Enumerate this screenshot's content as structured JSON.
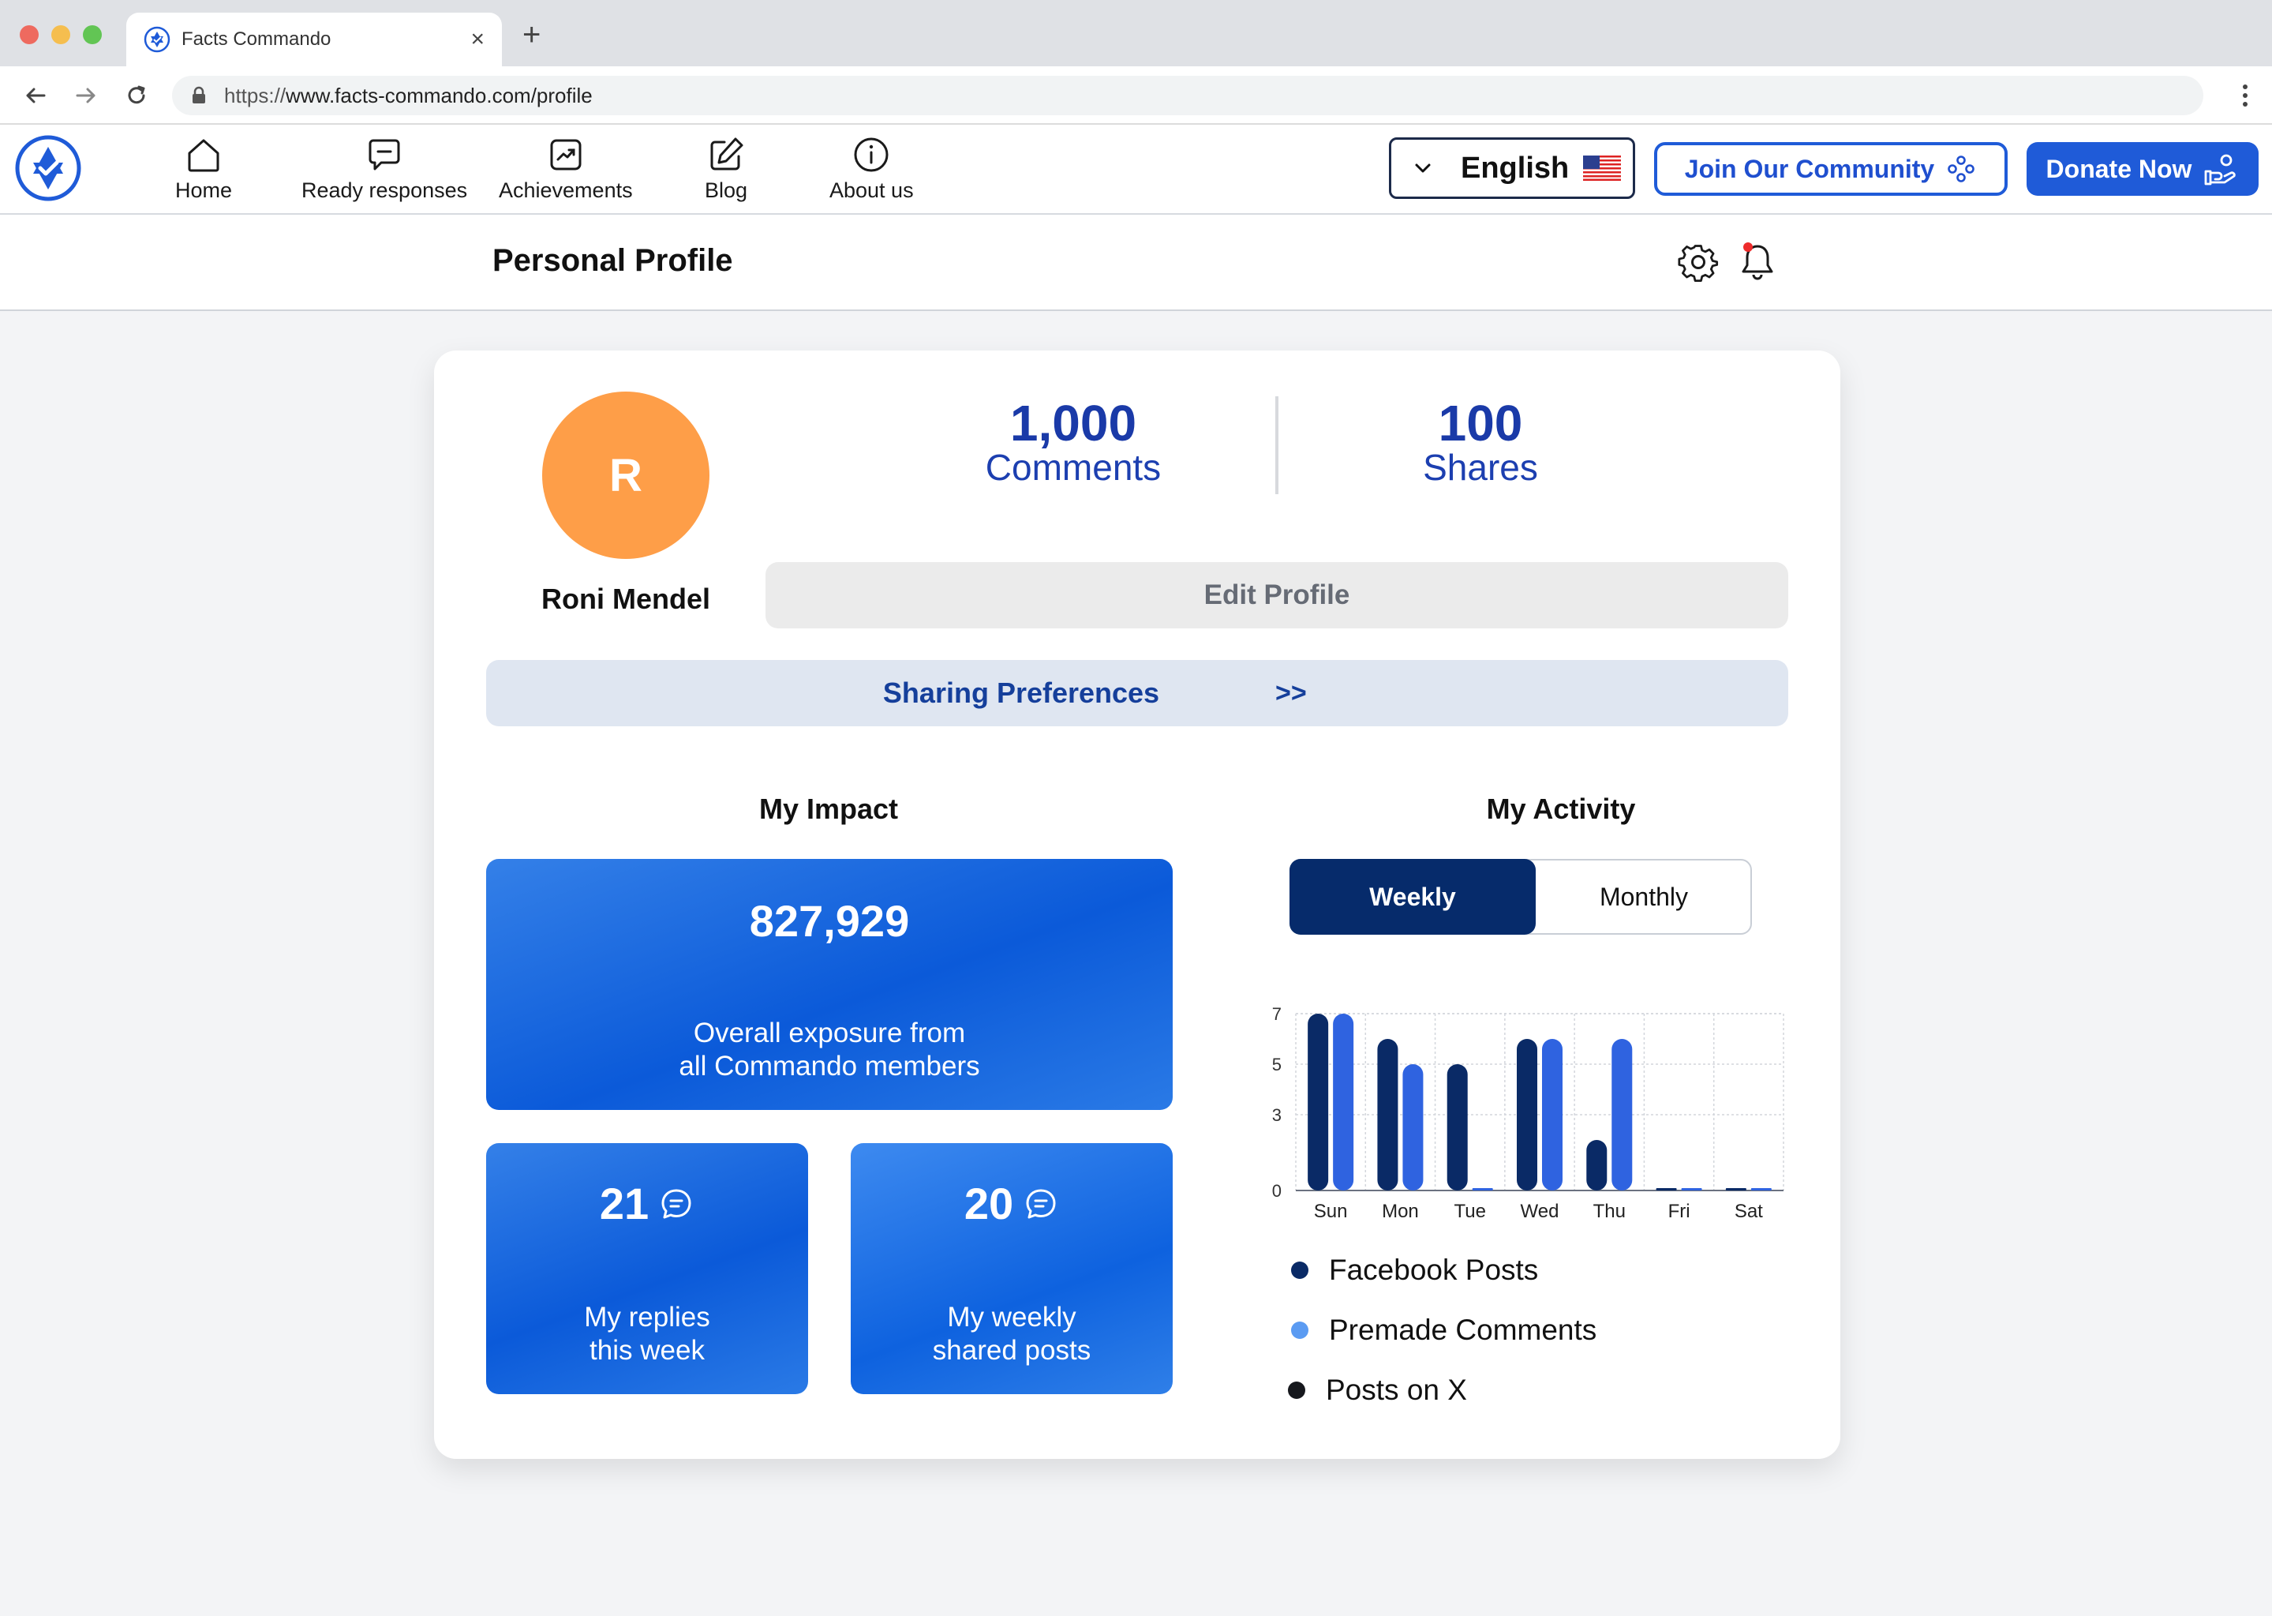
{
  "browser": {
    "tab_title": "Facts Commando",
    "url_scheme": "https://",
    "url_host": "www.facts-commando.com/profile"
  },
  "nav": {
    "items": [
      {
        "label": "Home",
        "icon": "home-icon"
      },
      {
        "label": "Ready responses",
        "icon": "chat-icon"
      },
      {
        "label": "Achievements",
        "icon": "chart-icon"
      },
      {
        "label": "Blog",
        "icon": "edit-icon"
      },
      {
        "label": "About us",
        "icon": "info-icon"
      }
    ],
    "language": "English",
    "join_label": "Join Our Community",
    "donate_label": "Donate Now"
  },
  "subheader": {
    "title": "Personal Profile"
  },
  "profile": {
    "initial": "R",
    "name": "Roni Mendel",
    "avatar_color": "#fe9e48",
    "stats": {
      "comments_value": "1,000",
      "comments_label": "Comments",
      "shares_value": "100",
      "shares_label": "Shares"
    },
    "edit_label": "Edit Profile",
    "sharing_label": "Sharing Preferences",
    "sharing_arrow": ">>"
  },
  "impact": {
    "title": "My Impact",
    "exposure_value": "827,929",
    "exposure_desc_line1": "Overall exposure from",
    "exposure_desc_line2": "all Commando members",
    "replies_value": "21",
    "replies_desc_line1": "My replies",
    "replies_desc_line2": "this week",
    "shared_value": "20",
    "shared_desc_line1": "My weekly",
    "shared_desc_line2": "shared posts"
  },
  "activity": {
    "title": "My Activity",
    "toggle_weekly": "Weekly",
    "toggle_monthly": "Monthly",
    "legend": [
      {
        "label": "Facebook Posts",
        "color": "#0a2a66"
      },
      {
        "label": "Premade Comments",
        "color": "#5b9bf2"
      },
      {
        "label": "Posts on X",
        "color": "#16181d"
      }
    ]
  },
  "chart_data": {
    "type": "bar",
    "categories": [
      "Sun",
      "Mon",
      "Tue",
      "Wed",
      "Thu",
      "Fri",
      "Sat"
    ],
    "series": [
      {
        "name": "Facebook Posts",
        "color": "#0a2a66",
        "values": [
          7,
          6,
          5,
          6,
          2,
          0,
          0
        ]
      },
      {
        "name": "Premade Comments",
        "color": "#2f63e0",
        "values": [
          7,
          5,
          0,
          6,
          6,
          0,
          0
        ]
      }
    ],
    "yticks": [
      0,
      3,
      5,
      7
    ],
    "ylim": [
      0,
      7
    ],
    "grid": true
  },
  "colors": {
    "brand_blue": "#1f5bd8",
    "dark_navy": "#062b6b",
    "stat_blue": "#1a3aa8"
  }
}
